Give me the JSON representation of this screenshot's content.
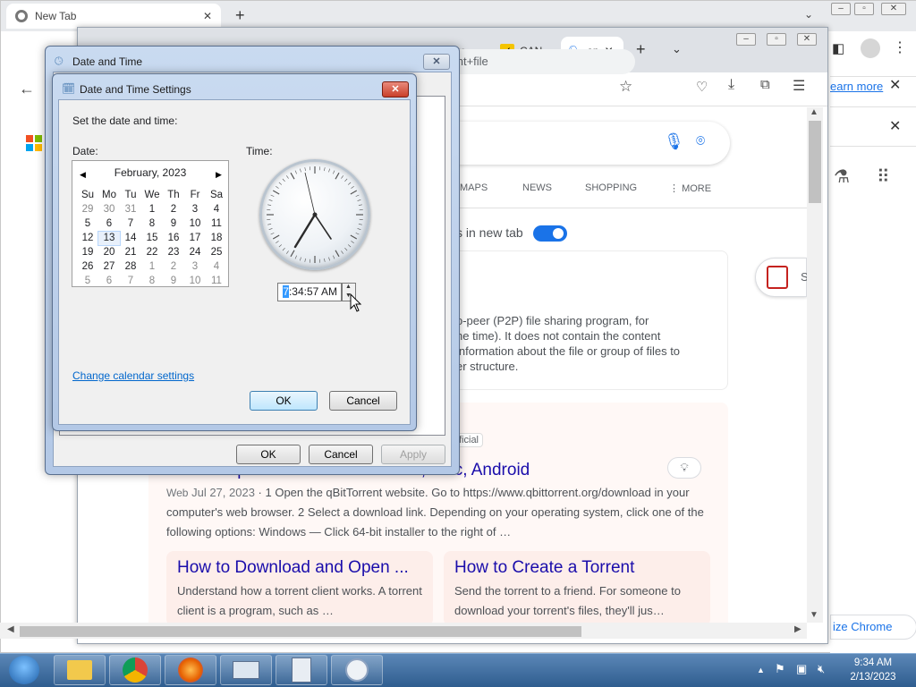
{
  "back_window": {
    "tab_title": "New Tab",
    "learn_more": "earn more",
    "customize": "ize Chrome"
  },
  "front_window": {
    "tabs": [
      "hare",
      "CAN",
      "op"
    ],
    "url_fragment": "&q=open+torrent+file",
    "nav_links": [
      "MAPS",
      "NEWS",
      "SHOPPING",
      "MORE"
    ],
    "new_tab_toggle_label": "s in new tab",
    "side_chip": "S",
    "result_text": "o-peer (P2P) file sharing program, for\nne time). It does not contain the content\ninformation about the file or group of files to\ner structure.",
    "official_badge": "ficial",
    "result_title": "How to Open a Torrent File on PC, Mac, Android",
    "result_meta_source": "Web",
    "result_meta_date": "Jul 27, 2023",
    "result_snippet": " · 1 Open the qBitTorrent website. Go to https://www.qbittorrent.org/download in your computer's web browser. 2 Select a download link. Depending on your operating system, click one of the following options: Windows — Click 64-bit installer to the right of …",
    "cards": [
      {
        "title": "How to Download and Open ...",
        "desc": "Understand how a torrent client works. A torrent client is a program, such as …"
      },
      {
        "title": "How to Create a Torrent",
        "desc": "Send the torrent to a friend. For someone to download your torrent's files, they'll jus…"
      }
    ]
  },
  "outer_dialog": {
    "title": "Date and Time",
    "ok": "OK",
    "cancel": "Cancel",
    "apply": "Apply"
  },
  "inner_dialog": {
    "title": "Date and Time Settings",
    "instruction": "Set the date and time:",
    "date_label": "Date:",
    "time_label": "Time:",
    "month_year": "February, 2023",
    "dow": [
      "Su",
      "Mo",
      "Tu",
      "We",
      "Th",
      "Fr",
      "Sa"
    ],
    "days": [
      [
        "29",
        "30",
        "31",
        "1",
        "2",
        "3",
        "4"
      ],
      [
        "5",
        "6",
        "7",
        "8",
        "9",
        "10",
        "11"
      ],
      [
        "12",
        "13",
        "14",
        "15",
        "16",
        "17",
        "18"
      ],
      [
        "19",
        "20",
        "21",
        "22",
        "23",
        "24",
        "25"
      ],
      [
        "26",
        "27",
        "28",
        "1",
        "2",
        "3",
        "4"
      ],
      [
        "5",
        "6",
        "7",
        "8",
        "9",
        "10",
        "11"
      ]
    ],
    "selected_day": "13",
    "time_hour_selected": "7",
    "time_rest": ":34:57 AM",
    "change_calendar": "Change calendar settings",
    "ok": "OK",
    "cancel": "Cancel"
  },
  "taskbar": {
    "time": "9:34 AM",
    "date": "2/13/2023"
  }
}
